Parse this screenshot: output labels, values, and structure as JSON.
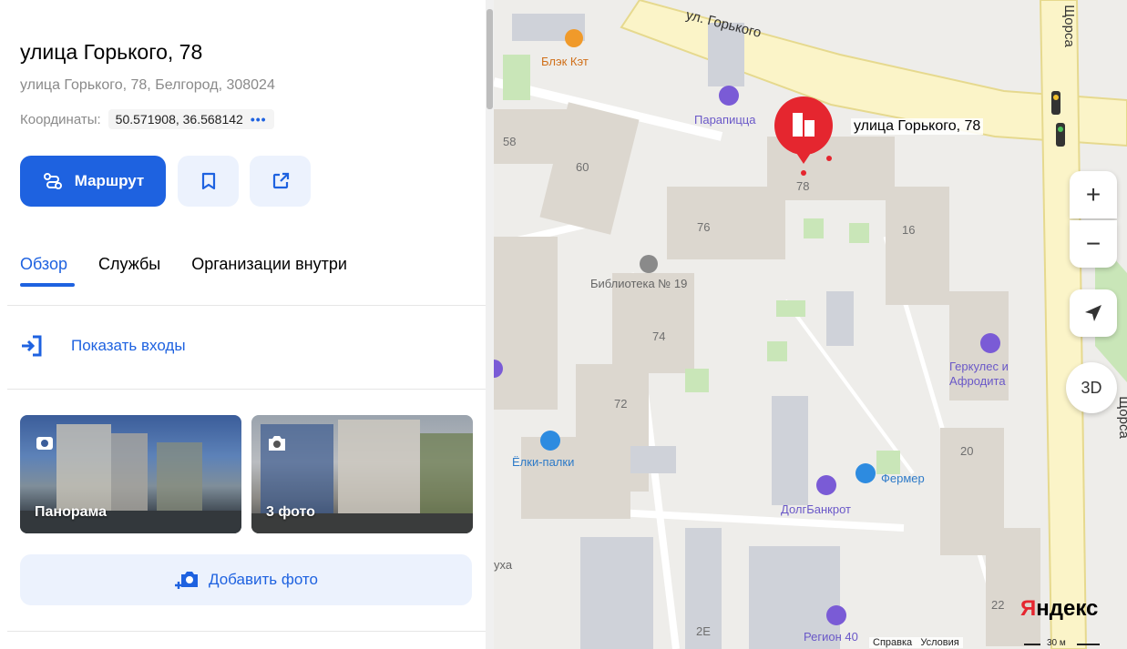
{
  "place": {
    "title": "улица Горького, 78",
    "address": "улица Горького, 78, Белгород, 308024",
    "coords_label": "Координаты:",
    "coords_value": "50.571908, 36.568142",
    "coords_more": "•••"
  },
  "actions": {
    "route_label": "Маршрут",
    "bookmark_icon": "bookmark-icon",
    "share_icon": "share-icon"
  },
  "tabs": [
    {
      "label": "Обзор",
      "active": true
    },
    {
      "label": "Службы",
      "active": false
    },
    {
      "label": "Организации внутри",
      "active": false
    }
  ],
  "entrances_label": "Показать входы",
  "photos": [
    {
      "label": "Панорама",
      "icon": "panorama-icon"
    },
    {
      "label": "3 фото",
      "icon": "camera-icon"
    }
  ],
  "add_photo_label": "Добавить фото",
  "map": {
    "pin_label": "улица Горького, 78",
    "street_labels": [
      "ул. Горького",
      "Щорса",
      "Щорса"
    ],
    "buildings": [
      "58",
      "60",
      "78",
      "76",
      "16",
      "74",
      "72",
      "20",
      "22",
      "2Е"
    ],
    "pois": [
      "Блэк Кэт",
      "Парапицца",
      "Библиотека № 19",
      "Геркулес и Афродита",
      "Ёлки-палки",
      "Фермер",
      "ДолгБанкрот",
      "Регион 40",
      "уха"
    ],
    "zoom_in": "+",
    "zoom_out": "−",
    "mode_3d": "3D",
    "brand": "Яндекс",
    "links": [
      "Справка",
      "Условия"
    ],
    "scale": "30 м",
    "accent_color": "#1e62e0",
    "pin_color": "#e5262f"
  }
}
